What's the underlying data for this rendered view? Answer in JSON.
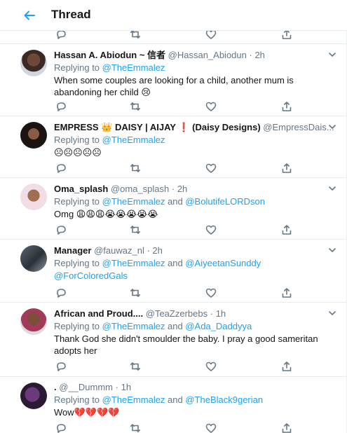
{
  "header": {
    "title": "Thread"
  },
  "tweets": [
    {
      "name": "Hassan A. Abiodun ~ 信者",
      "handle": "@Hassan_Abiodun",
      "time": "2h",
      "replying_prefix": "Replying to ",
      "mention1": "@TheEmmalez",
      "joiner": "",
      "mention2": "",
      "mention3": "",
      "text": "When some couples are looking for a child, another mum is abandoning her child 😢"
    },
    {
      "name": "EMPRESS 👑 DAISY | AIJAY ❗ (Daisy Designs)",
      "handle": "@EmpressDais...",
      "time": "2h",
      "replying_prefix": "Replying to ",
      "mention1": "@TheEmmalez",
      "joiner": "",
      "mention2": "",
      "mention3": "",
      "text": "☹☹☹☹☹"
    },
    {
      "name": "Oma_splash",
      "handle": "@oma_splash",
      "time": "2h",
      "replying_prefix": "Replying to ",
      "mention1": "@TheEmmalez",
      "joiner": " and ",
      "mention2": "@BolutifeLORDson",
      "mention3": "",
      "text": "Omg 😩😩😩😭😭😭😭😭"
    },
    {
      "name": "Manager",
      "handle": "@fauwaz_nl",
      "time": "2h",
      "replying_prefix": "Replying to ",
      "mention1": "@TheEmmalez",
      "joiner": " and ",
      "mention2": "@AiyeetanSunddy",
      "mention3": "@ForColoredGals",
      "text": ""
    },
    {
      "name": "African and Proud....",
      "handle": "@TeaZzerbebs",
      "time": "1h",
      "replying_prefix": "Replying to ",
      "mention1": "@TheEmmalez",
      "joiner": " and ",
      "mention2": "@Ada_Daddyya",
      "mention3": "",
      "text": "Thank God she didn't smoulder the baby. I pray a good sameritan adopts her"
    },
    {
      "name": ".",
      "handle": "@__Dummm",
      "time": "1h",
      "replying_prefix": "Replying to ",
      "mention1": "@TheEmmalez",
      "joiner": " and ",
      "mention2": "@TheBlack9gerian",
      "mention3": "",
      "text": "Wow💔💔💔💔"
    }
  ],
  "colors": {
    "link": "#1da1f2",
    "muted": "#657786",
    "text": "#14171a",
    "border": "#e6ecf0"
  },
  "icons": {
    "back": "arrow-left-icon",
    "reply": "reply-icon",
    "retweet": "retweet-icon",
    "like": "heart-icon",
    "share": "share-icon",
    "more": "chevron-down-icon"
  }
}
